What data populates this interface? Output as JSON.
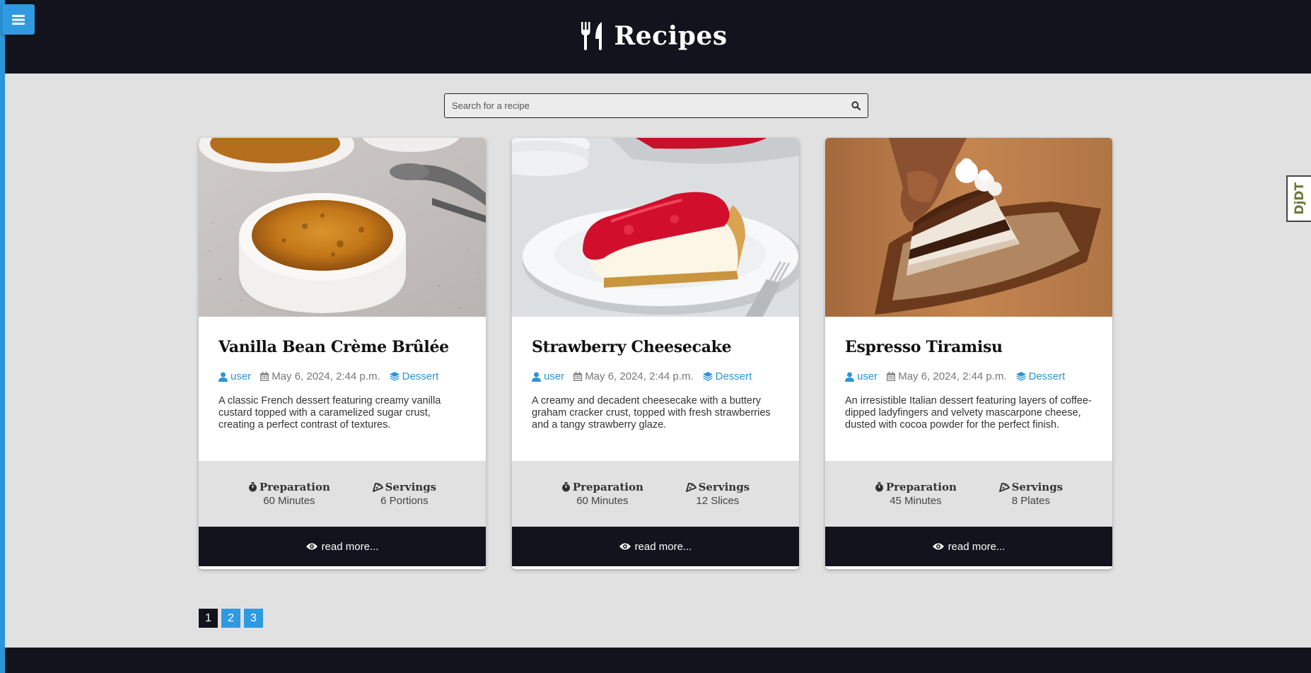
{
  "header": {
    "title": "Recipes"
  },
  "search": {
    "placeholder": "Search for a recipe"
  },
  "recipes": [
    {
      "title": "Vanilla Bean Crème Brûlée",
      "author": "user",
      "date": "May 6, 2024, 2:44 p.m.",
      "category": "Dessert",
      "description": "A classic French dessert featuring creamy vanilla custard topped with a caramelized sugar crust, creating a perfect contrast of textures.",
      "prep_label": "Preparation",
      "prep_value": "60 Minutes",
      "servings_label": "Servings",
      "servings_value": "6 Portions",
      "read_more": "read more..."
    },
    {
      "title": "Strawberry Cheesecake",
      "author": "user",
      "date": "May 6, 2024, 2:44 p.m.",
      "category": "Dessert",
      "description": "A creamy and decadent cheesecake with a buttery graham cracker crust, topped with fresh strawberries and a tangy strawberry glaze.",
      "prep_label": "Preparation",
      "prep_value": "60 Minutes",
      "servings_label": "Servings",
      "servings_value": "12 Slices",
      "read_more": "read more..."
    },
    {
      "title": "Espresso Tiramisu",
      "author": "user",
      "date": "May 6, 2024, 2:44 p.m.",
      "category": "Dessert",
      "description": "An irresistible Italian dessert featuring layers of coffee-dipped ladyfingers and velvety mascarpone cheese, dusted with cocoa powder for the perfect finish.",
      "prep_label": "Preparation",
      "prep_value": "45 Minutes",
      "servings_label": "Servings",
      "servings_value": "8 Plates",
      "read_more": "read more..."
    }
  ],
  "pagination": {
    "pages": [
      "1",
      "2",
      "3"
    ],
    "current": "1"
  },
  "side_widget": {
    "label": "DjDT"
  },
  "colors": {
    "dark": "#13131e",
    "accent": "#2b95d9",
    "background": "#e1e1e1"
  },
  "icons": {
    "menu": "bars-icon",
    "brand": "utensils-icon",
    "search": "search-icon",
    "author": "user-icon",
    "date": "calendar-icon",
    "category": "layers-icon",
    "prep": "stopwatch-icon",
    "servings": "pizza-slice-icon",
    "read_more": "eye-icon"
  }
}
